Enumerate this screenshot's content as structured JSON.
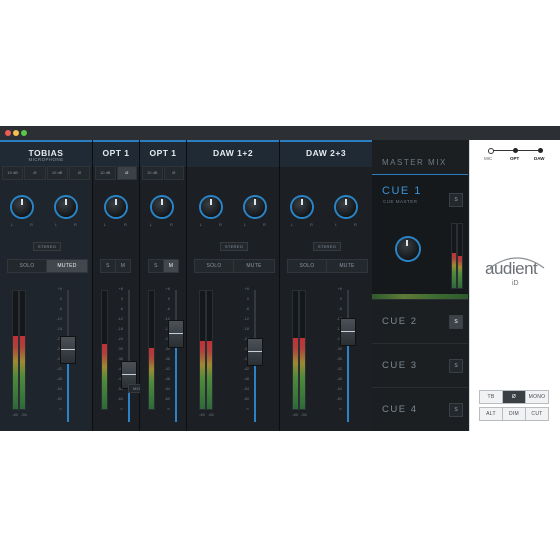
{
  "window": {
    "traffic_lights": [
      "#ed5e57",
      "#f5be4f",
      "#59c84a"
    ]
  },
  "channels": [
    {
      "name": "TOBIAS",
      "sub": "MICROPHONE",
      "buttons": [
        "10 dB",
        "Ø",
        "10 dB",
        "Ø"
      ],
      "mode": "STEREO",
      "solo": "SOLO",
      "mute": "MUTED",
      "meter_level": 0.62
    },
    {
      "name": "OPT 1",
      "sub": "",
      "buttons": [
        "10 dB",
        "Ø"
      ],
      "mode": "",
      "solo": "S",
      "mute": "M",
      "meter_level": 0.55
    },
    {
      "name": "OPT 1",
      "sub": "",
      "buttons": [
        "10 dB",
        "Ø"
      ],
      "mode": "",
      "solo": "S",
      "mute": "M",
      "meter_level": 0.52
    },
    {
      "name": "DAW 1+2",
      "sub": "",
      "buttons": [],
      "mode": "STEREO",
      "solo": "SOLO",
      "mute": "MUTE",
      "meter_level": 0.58
    },
    {
      "name": "DAW 2+3",
      "sub": "",
      "buttons": [],
      "mode": "STEREO",
      "solo": "SOLO",
      "mute": "MUTE",
      "meter_level": 0.6
    }
  ],
  "opt_mode": "MONO",
  "scale_ticks": [
    "+6",
    "0",
    "-6",
    "-12",
    "-18",
    "-24",
    "-30",
    "-36",
    "-42",
    "-48",
    "-54",
    "-60",
    "∞"
  ],
  "meter_ticks": [
    "-45",
    "-54"
  ],
  "knob_labels": {
    "l": "L",
    "r": "R"
  },
  "master": {
    "label": "MASTER MIX"
  },
  "cues": [
    {
      "name": "CUE 1",
      "sub": "CUE MASTER",
      "button": "S",
      "active": true
    },
    {
      "name": "CUE 2",
      "button": "S",
      "active": false
    },
    {
      "name": "CUE 3",
      "button": "S",
      "active": false
    },
    {
      "name": "CUE 4",
      "button": "S",
      "active": false
    }
  ],
  "panel": {
    "sources": [
      "MIC",
      "OPT",
      "DAW"
    ],
    "logo": "audient",
    "logo_sub": "iD",
    "buttons_row1": [
      "TB",
      "Ø",
      "MONO"
    ],
    "buttons_row2": [
      "ALT",
      "DIM",
      "CUT"
    ]
  },
  "colors": {
    "accent": "#2b82c7",
    "bg": "#1b1f23"
  }
}
